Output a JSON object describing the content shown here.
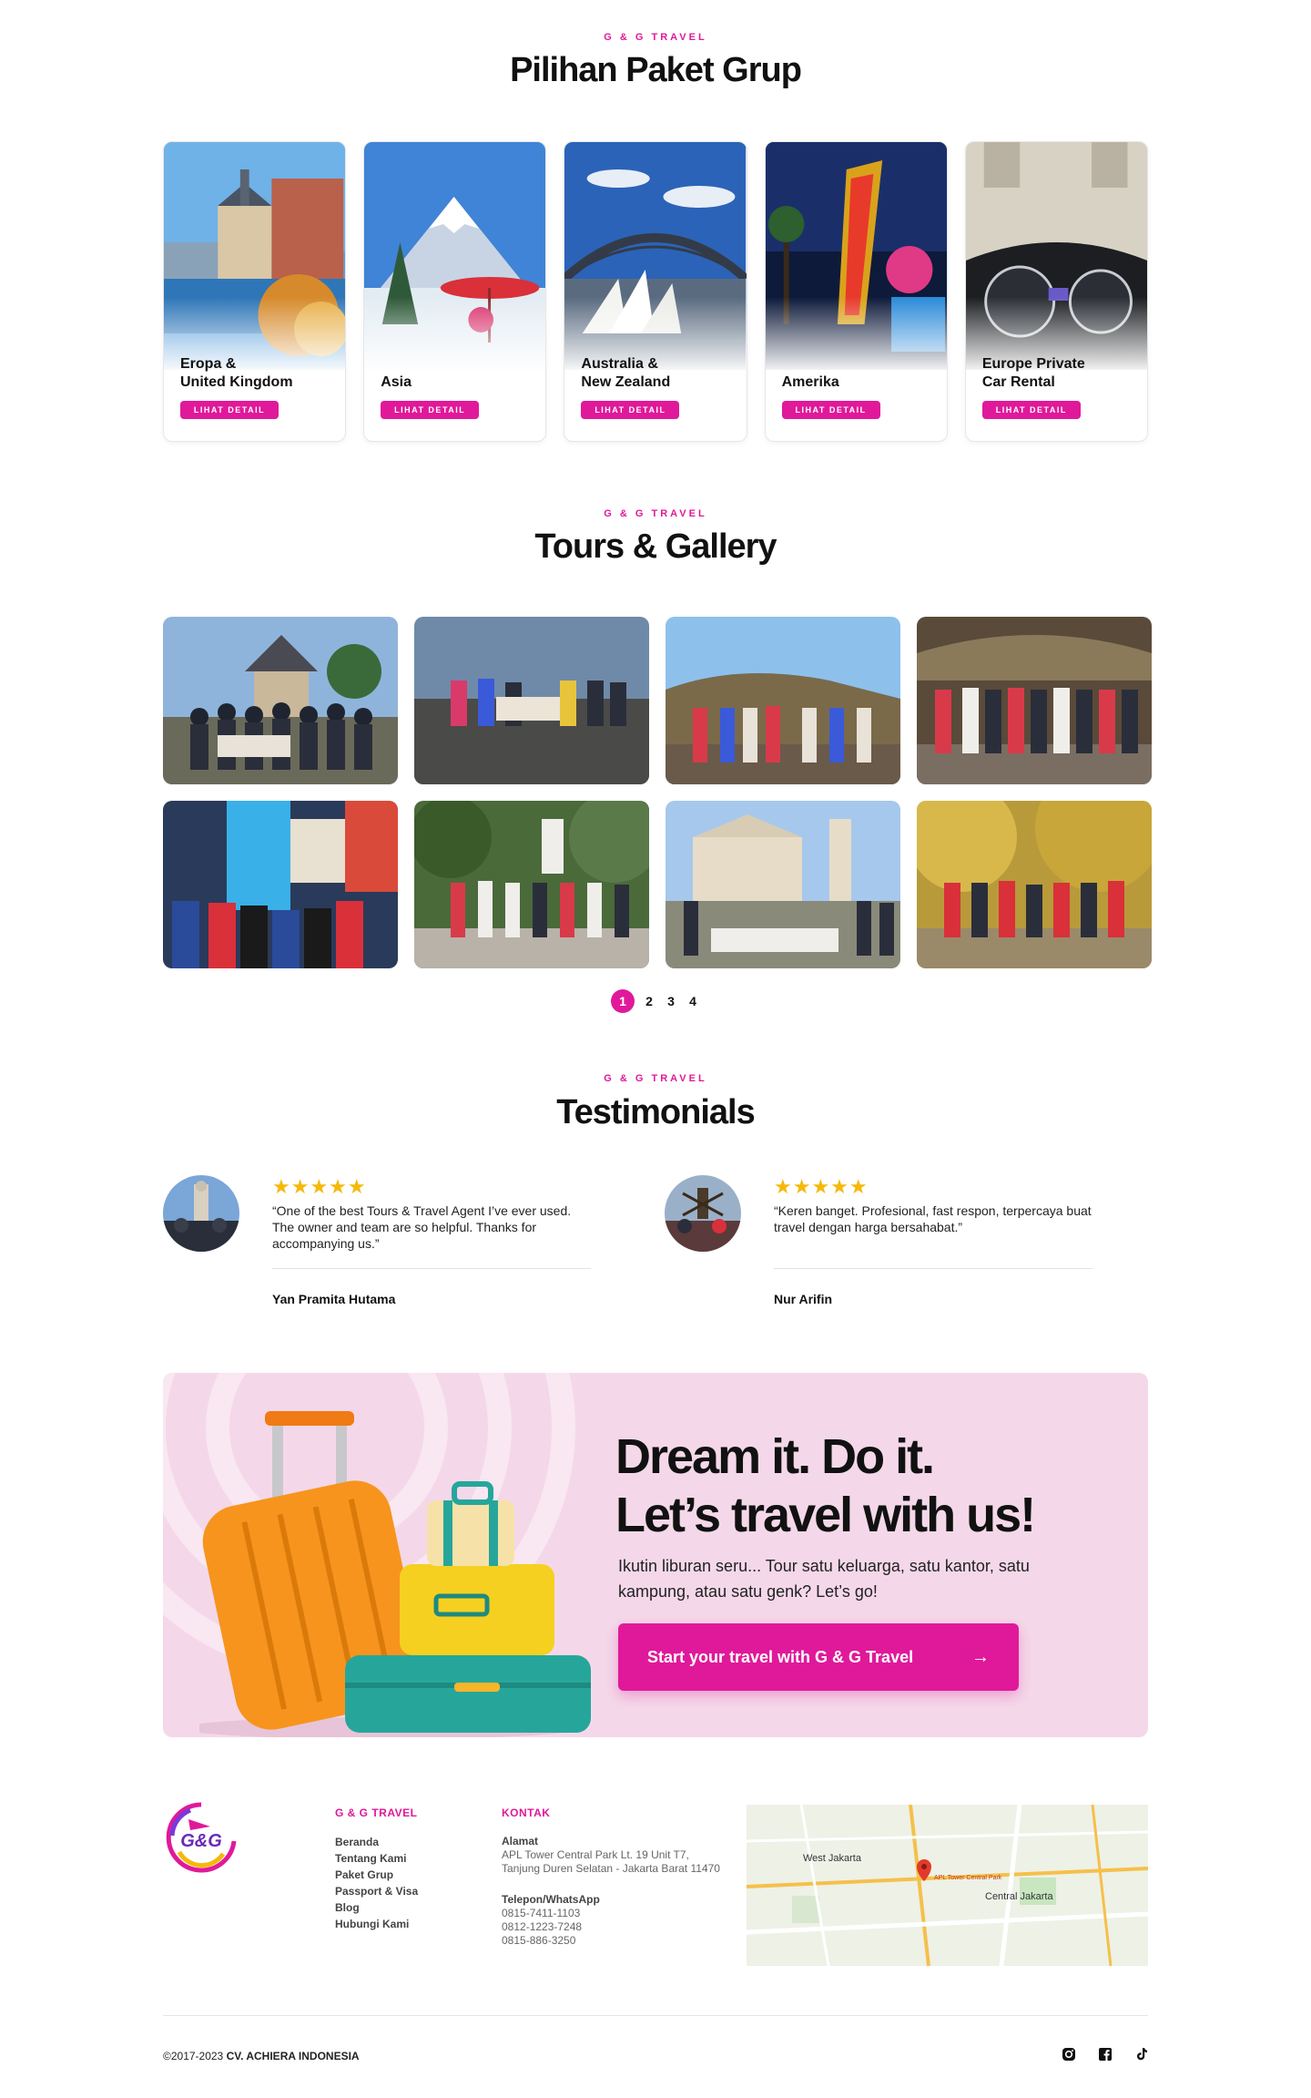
{
  "brand": {
    "accent": "#e0199a",
    "star_color": "#f5b90a"
  },
  "packages": {
    "eyebrow": "G & G TRAVEL",
    "title": "Pilihan Paket Grup",
    "button_label": "LIHAT DETAIL",
    "items": [
      {
        "name": "Eropa &\nUnited Kingdom"
      },
      {
        "name": "Asia"
      },
      {
        "name": "Australia &\nNew Zealand"
      },
      {
        "name": "Amerika"
      },
      {
        "name": "Europe Private\nCar Rental"
      }
    ]
  },
  "gallery": {
    "eyebrow": "G & G TRAVEL",
    "title": "Tours & Gallery",
    "pages": [
      "1",
      "2",
      "3",
      "4"
    ],
    "current_page": "1"
  },
  "testimonials": {
    "eyebrow": "G & G TRAVEL",
    "title": "Testimonials",
    "items": [
      {
        "stars": "★★★★★",
        "rating": 5,
        "quote": "“One of the best Tours & Travel Agent I’ve ever used. The owner and team are so helpful. Thanks for accompanying us.”",
        "name": "Yan Pramita Hutama"
      },
      {
        "stars": "★★★★★",
        "rating": 5,
        "quote": "“Keren banget. Profesional, fast respon, terpercaya buat travel dengan harga bersahabat.”",
        "name": "Nur Arifin"
      }
    ]
  },
  "cta": {
    "heading_line1": "Dream it. Do it.",
    "heading_line2": "Let’s travel with us!",
    "text": "Ikutin liburan seru... Tour satu keluarga, satu kantor, satu kampung, atau satu genk? Let’s go!",
    "button_label": "Start your travel with G & G Travel",
    "button_icon": "arrow-right-icon"
  },
  "footer": {
    "logo_text": "G&G",
    "nav_heading": "G & G TRAVEL",
    "nav_links": [
      "Beranda",
      "Tentang Kami",
      "Paket Grup",
      "Passport & Visa",
      "Blog",
      "Hubungi Kami"
    ],
    "contact_heading": "KONTAK",
    "address_label": "Alamat",
    "address": "APL Tower Central Park Lt. 19 Unit T7, Tanjung Duren Selatan - Jakarta Barat 11470",
    "phone_label": "Telepon/WhatsApp",
    "phones": [
      "0815-7411-1103",
      "0812-1223-7248",
      "0815-886-3250"
    ],
    "map_labels": {
      "west": "West Jakarta",
      "central": "Central Jakarta",
      "pin": "APL Tower Central Park"
    },
    "copyright_prefix": "©2017-2023 ",
    "copyright_company": "CV. ACHIERA INDONESIA",
    "social_icons": [
      "instagram-icon",
      "facebook-icon",
      "tiktok-icon"
    ]
  }
}
